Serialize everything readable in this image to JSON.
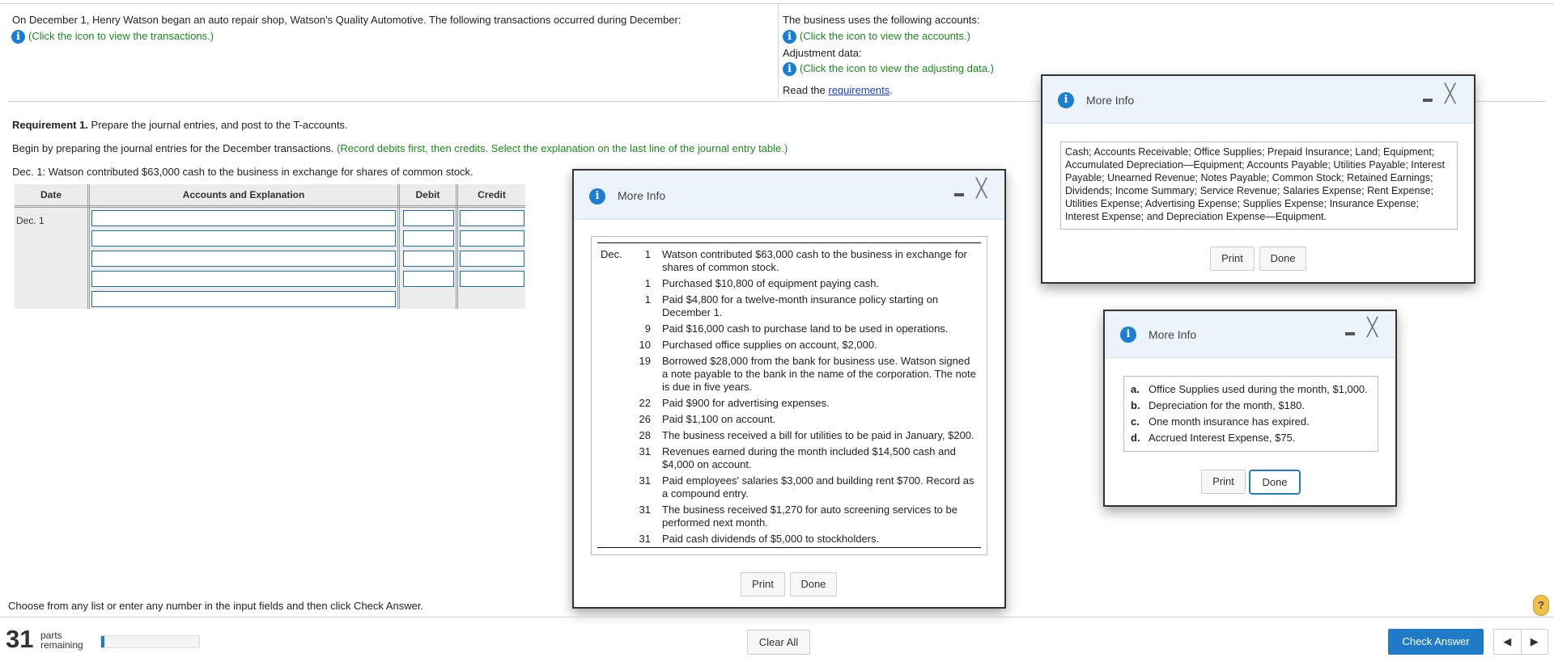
{
  "intro": {
    "text": "On December 1, Henry Watson began an auto repair shop, Watson's Quality Automotive. The following transactions occurred during December:",
    "transactions_link": "(Click the icon to view the transactions.)"
  },
  "right_panel": {
    "accounts_text": "The business uses the following accounts:",
    "accounts_link": "(Click the icon to view the accounts.)",
    "adjustment_label": "Adjustment data:",
    "adjusting_link": "(Click the icon to view the adjusting data.)",
    "read_prefix": "Read the ",
    "requirements_link": "requirements",
    "read_suffix": "."
  },
  "requirement": {
    "bold": "Requirement 1.",
    "text": " Prepare the journal entries, and post to the T-accounts.",
    "begin": "Begin by preparing the journal entries for the December transactions. ",
    "begin_note": "(Record debits first, then credits. Select the explanation on the last line of the journal entry table.)",
    "dec1": "Dec. 1: Watson contributed $63,000 cash to the business in exchange for shares of common stock."
  },
  "journal": {
    "headers": [
      "Date",
      "Accounts and Explanation",
      "Debit",
      "Credit"
    ],
    "date": "Dec. 1"
  },
  "transactions_modal": {
    "title": "More Info",
    "month": "Dec.",
    "rows": [
      {
        "day": "1",
        "text": "Watson contributed $63,000 cash to the business in exchange for shares of common stock."
      },
      {
        "day": "1",
        "text": "Purchased $10,800 of equipment paying cash."
      },
      {
        "day": "1",
        "text": "Paid $4,800 for a twelve-month insurance policy starting on December 1."
      },
      {
        "day": "9",
        "text": "Paid $16,000 cash to purchase land to be used in operations."
      },
      {
        "day": "10",
        "text": "Purchased office supplies on account, $2,000."
      },
      {
        "day": "19",
        "text": "Borrowed $28,000 from the bank for business use. Watson signed a note payable to the bank in the name of the corporation. The note is due in five years."
      },
      {
        "day": "22",
        "text": "Paid $900 for advertising expenses."
      },
      {
        "day": "26",
        "text": "Paid $1,100 on account."
      },
      {
        "day": "28",
        "text": "The business received a bill for utilities to be paid in January, $200."
      },
      {
        "day": "31",
        "text": "Revenues earned during the month included $14,500 cash and $4,000 on account."
      },
      {
        "day": "31",
        "text": "Paid employees' salaries $3,000 and building rent $700. Record as a compound entry."
      },
      {
        "day": "31",
        "text": "The business received $1,270 for auto screening services to be performed next month."
      },
      {
        "day": "31",
        "text": "Paid cash dividends of $5,000 to stockholders."
      }
    ],
    "print": "Print",
    "done": "Done"
  },
  "accounts_modal": {
    "title": "More Info",
    "text": "Cash; Accounts Receivable; Office Supplies; Prepaid Insurance; Land; Equipment; Accumulated Depreciation—Equipment; Accounts Payable; Utilities Payable; Interest Payable; Unearned Revenue; Notes Payable; Common Stock; Retained Earnings; Dividends; Income Summary; Service Revenue; Salaries Expense; Rent Expense; Utilities Expense; Advertising Expense; Supplies Expense; Insurance Expense; Interest Expense; and Depreciation Expense—Equipment.",
    "print": "Print",
    "done": "Done"
  },
  "adjusting_modal": {
    "title": "More Info",
    "items": [
      {
        "letter": "a.",
        "text": "Office Supplies used during the month, $1,000."
      },
      {
        "letter": "b.",
        "text": "Depreciation for the month, $180."
      },
      {
        "letter": "c.",
        "text": "One month insurance has expired."
      },
      {
        "letter": "d.",
        "text": "Accrued Interest Expense, $75."
      }
    ],
    "print": "Print",
    "done": "Done"
  },
  "footer": {
    "instruction": "Choose from any list or enter any number in the input fields and then click Check Answer.",
    "parts_count": "31",
    "parts_label1": "parts",
    "parts_label2": "remaining",
    "progress_percent": 3,
    "clear_all": "Clear All",
    "check_answer": "Check Answer",
    "help": "?"
  },
  "colors": {
    "accent": "#1f7bc8",
    "green_note": "#1a8a1a",
    "modal_header": "#edf3fb"
  }
}
